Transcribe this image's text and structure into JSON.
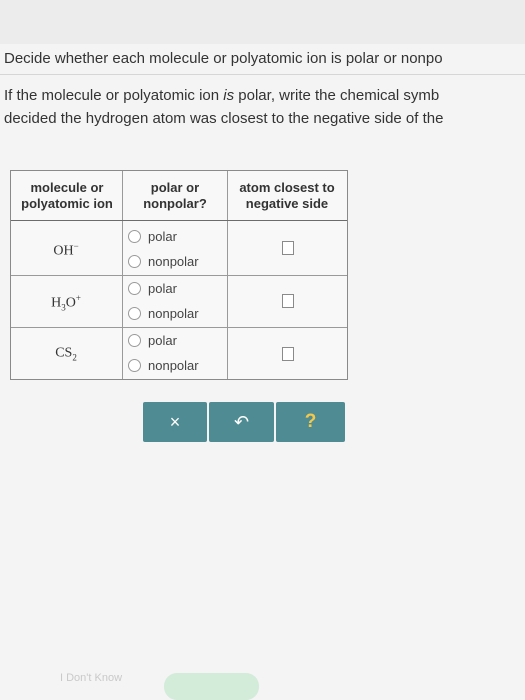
{
  "question": "Decide whether each molecule or polyatomic ion is polar or nonpo",
  "instructions": {
    "line1_before": "If the molecule or polyatomic ion ",
    "line1_italic": "is",
    "line1_after": " polar, write the chemical symb",
    "line2": "decided the hydrogen atom was closest to the negative side of the"
  },
  "table": {
    "headers": {
      "col1_line1": "molecule or",
      "col1_line2": "polyatomic ion",
      "col2_line1": "polar or",
      "col2_line2": "nonpolar?",
      "col3_line1": "atom closest to",
      "col3_line2": "negative side"
    },
    "rows": [
      {
        "molecule_base": "OH",
        "molecule_sub": "",
        "molecule_base2": "",
        "molecule_sup": "−",
        "option_polar": "polar",
        "option_nonpolar": "nonpolar"
      },
      {
        "molecule_base": "H",
        "molecule_sub": "3",
        "molecule_base2": "O",
        "molecule_sup": "+",
        "option_polar": "polar",
        "option_nonpolar": "nonpolar"
      },
      {
        "molecule_base": "CS",
        "molecule_sub": "2",
        "molecule_base2": "",
        "molecule_sup": "",
        "option_polar": "polar",
        "option_nonpolar": "nonpolar"
      }
    ]
  },
  "buttons": {
    "clear_symbol": "×",
    "undo_symbol": "↶",
    "help_symbol": "?"
  },
  "footer": {
    "dont_know": "I Don't Know"
  },
  "colors": {
    "button_teal": "#4f8b92",
    "help_yellow": "#f2c94c",
    "submit_green": "#d3ebd9"
  },
  "icons": [
    "close-icon",
    "undo-icon",
    "help-icon",
    "radio-icon",
    "checkbox-icon"
  ]
}
